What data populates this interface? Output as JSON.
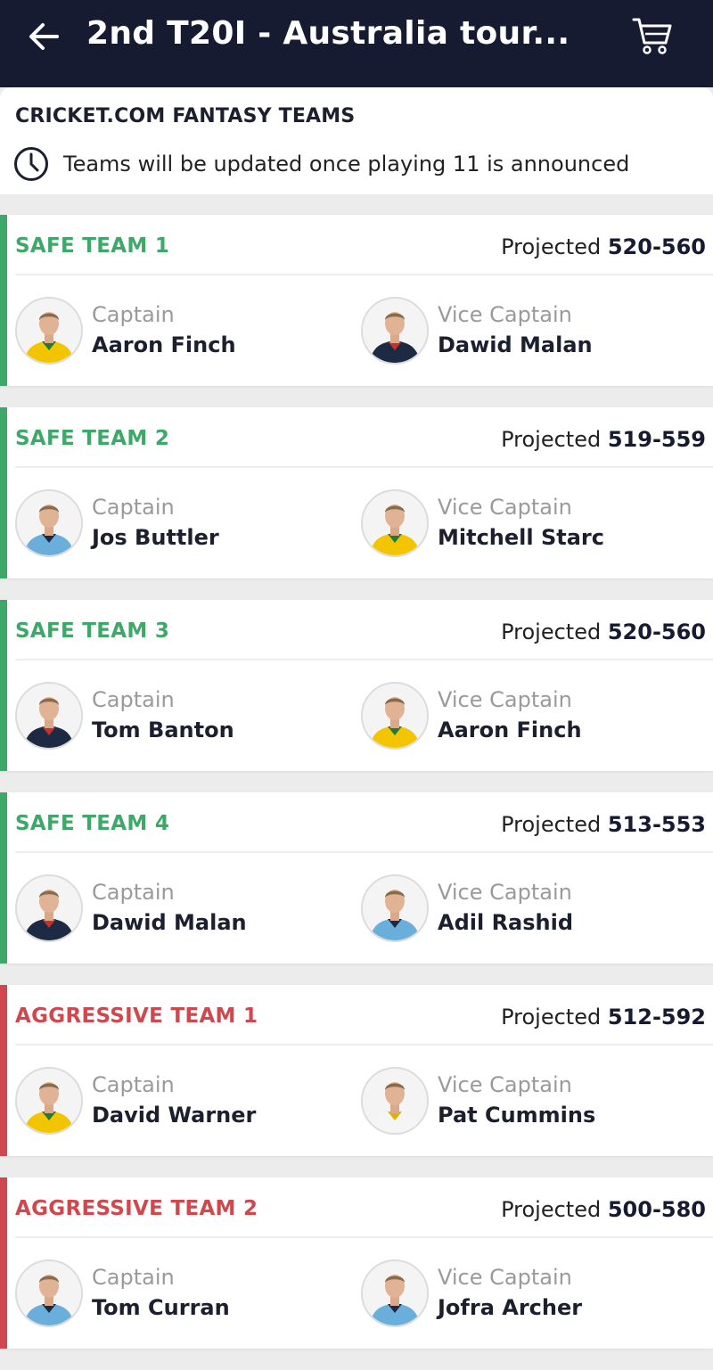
{
  "header": {
    "title": "2nd T20I - Australia tour...",
    "back_icon": "arrow-left-icon",
    "cart_icon": "cart-icon"
  },
  "info": {
    "title": "CRICKET.COM FANTASY TEAMS",
    "note": "Teams will be updated once playing 11 is announced",
    "icon": "clock-icon"
  },
  "colors": {
    "safe": "#3ea869",
    "aggressive": "#d0484d",
    "header_bg": "#161b31"
  },
  "teams": [
    {
      "name": "SAFE TEAM 1",
      "type": "safe",
      "projected_label": "Projected",
      "range": "520-560",
      "captain": {
        "role": "Captain",
        "name": "Aaron Finch",
        "kit": "australia"
      },
      "vice": {
        "role": "Vice Captain",
        "name": "Dawid Malan",
        "kit": "england-dark"
      }
    },
    {
      "name": "SAFE TEAM 2",
      "type": "safe",
      "projected_label": "Projected",
      "range": "519-559",
      "captain": {
        "role": "Captain",
        "name": "Jos Buttler",
        "kit": "england-light"
      },
      "vice": {
        "role": "Vice Captain",
        "name": "Mitchell Starc",
        "kit": "australia"
      }
    },
    {
      "name": "SAFE TEAM 3",
      "type": "safe",
      "projected_label": "Projected",
      "range": "520-560",
      "captain": {
        "role": "Captain",
        "name": "Tom Banton",
        "kit": "england-dark"
      },
      "vice": {
        "role": "Vice Captain",
        "name": "Aaron Finch",
        "kit": "australia"
      }
    },
    {
      "name": "SAFE TEAM 4",
      "type": "safe",
      "projected_label": "Projected",
      "range": "513-553",
      "captain": {
        "role": "Captain",
        "name": "Dawid Malan",
        "kit": "england-dark"
      },
      "vice": {
        "role": "Vice Captain",
        "name": "Adil Rashid",
        "kit": "england-light"
      }
    },
    {
      "name": "AGGRESSIVE TEAM 1",
      "type": "aggressive",
      "projected_label": "Projected",
      "range": "512-592",
      "captain": {
        "role": "Captain",
        "name": "David Warner",
        "kit": "australia"
      },
      "vice": {
        "role": "Vice Captain",
        "name": "Pat Cummins",
        "kit": "white"
      }
    },
    {
      "name": "AGGRESSIVE TEAM 2",
      "type": "aggressive",
      "projected_label": "Projected",
      "range": "500-580",
      "captain": {
        "role": "Captain",
        "name": "Tom Curran",
        "kit": "england-light"
      },
      "vice": {
        "role": "Vice Captain",
        "name": "Jofra Archer",
        "kit": "england-light"
      }
    }
  ]
}
